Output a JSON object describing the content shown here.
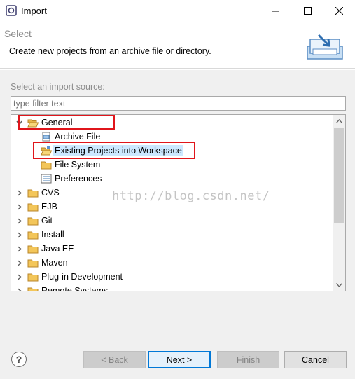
{
  "window": {
    "title": "Import",
    "minimize_label": "—",
    "maximize_label": "☐",
    "close_label": "✕"
  },
  "header": {
    "title": "Select",
    "description": "Create new projects from an archive file or directory."
  },
  "source": {
    "label": "Select an import source:",
    "filter_placeholder": "type filter text"
  },
  "tree": {
    "rows": [
      {
        "label": "General",
        "expanded": true,
        "level": 0,
        "icon": "folder-open-icon"
      },
      {
        "label": "Archive File",
        "level": 1,
        "icon": "archive-file-icon"
      },
      {
        "label": "Existing Projects into Workspace",
        "level": 1,
        "icon": "project-folder-icon",
        "selected": true
      },
      {
        "label": "File System",
        "level": 1,
        "icon": "folder-icon"
      },
      {
        "label": "Preferences",
        "level": 1,
        "icon": "preferences-icon"
      },
      {
        "label": "CVS",
        "level": 0,
        "icon": "folder-icon"
      },
      {
        "label": "EJB",
        "level": 0,
        "icon": "folder-icon"
      },
      {
        "label": "Git",
        "level": 0,
        "icon": "folder-icon"
      },
      {
        "label": "Install",
        "level": 0,
        "icon": "folder-icon"
      },
      {
        "label": "Java EE",
        "level": 0,
        "icon": "folder-icon"
      },
      {
        "label": "Maven",
        "level": 0,
        "icon": "folder-icon"
      },
      {
        "label": "Plug-in Development",
        "level": 0,
        "icon": "folder-icon"
      },
      {
        "label": "Remote Systems",
        "level": 0,
        "icon": "folder-icon"
      }
    ]
  },
  "watermark": "http://blog.csdn.net/",
  "footer": {
    "help_label": "?",
    "back_label": "< Back",
    "next_label": "Next >",
    "finish_label": "Finish",
    "cancel_label": "Cancel"
  },
  "colors": {
    "accent": "#0078d7",
    "selection": "#cce8ff",
    "highlight_box": "#e0151b",
    "folder": "#e8b54a"
  }
}
